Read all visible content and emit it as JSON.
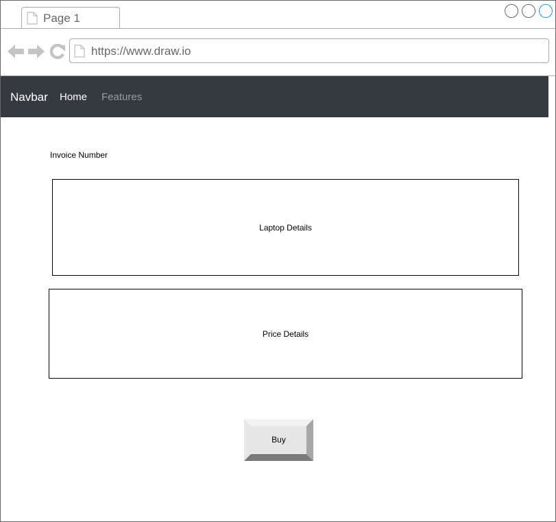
{
  "browser": {
    "tab_title": "Page 1",
    "tab_icon": "page-icon",
    "url": "https://www.draw.io",
    "url_icon": "page-icon",
    "window_controls": [
      "circle",
      "circle",
      "circle"
    ],
    "nav_icons": [
      "back-arrow-icon",
      "forward-arrow-icon",
      "reload-icon"
    ]
  },
  "navbar": {
    "brand": "Navbar",
    "links": [
      {
        "label": "Home",
        "active": true
      },
      {
        "label": "Features",
        "active": false
      }
    ],
    "background": "#343a40"
  },
  "main": {
    "invoice_label": "Invoice Number",
    "laptop_box_label": "Laptop Details",
    "price_box_label": "Price Details",
    "buy_button_label": "Buy"
  },
  "colors": {
    "accent_window_button": "#1ba1e2",
    "chrome_gray": "#a8a8a8"
  }
}
